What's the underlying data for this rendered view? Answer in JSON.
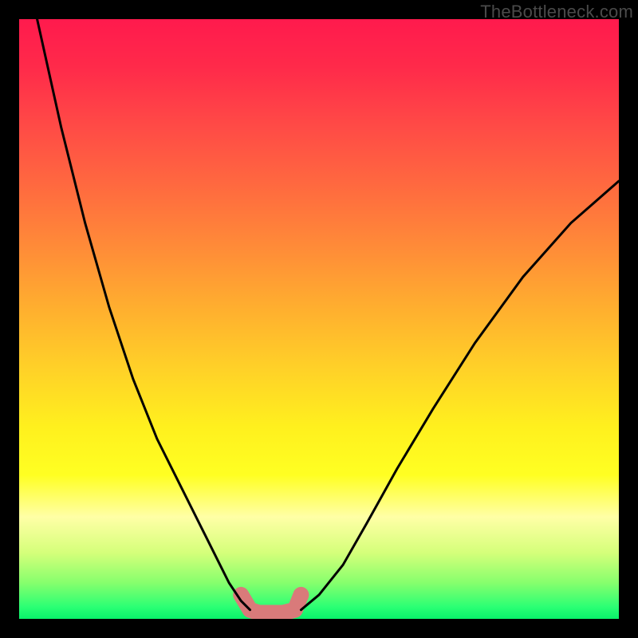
{
  "watermark": {
    "text": "TheBottleneck.com"
  },
  "chart_data": {
    "type": "line",
    "title": "",
    "xlabel": "",
    "ylabel": "",
    "xlim": [
      0,
      100
    ],
    "ylim": [
      0,
      100
    ],
    "series": [
      {
        "name": "left-curve",
        "x": [
          3,
          7,
          11,
          15,
          19,
          23,
          27,
          31,
          33,
          35,
          37,
          38.5
        ],
        "y": [
          100,
          82,
          66,
          52,
          40,
          30,
          22,
          14,
          10,
          6,
          3,
          1.5
        ]
      },
      {
        "name": "right-curve",
        "x": [
          47,
          50,
          54,
          58,
          63,
          69,
          76,
          84,
          92,
          100
        ],
        "y": [
          1.5,
          4,
          9,
          16,
          25,
          35,
          46,
          57,
          66,
          73
        ]
      },
      {
        "name": "bottom-marker",
        "x": [
          37,
          38.5,
          40,
          42,
          44,
          46,
          47
        ],
        "y": [
          4,
          1.5,
          1,
          1,
          1,
          1.5,
          4
        ]
      }
    ],
    "colors": {
      "curve": "#000000",
      "marker": "#d97a7a"
    },
    "stroke_widths": {
      "curve": 3,
      "marker": 20
    }
  }
}
